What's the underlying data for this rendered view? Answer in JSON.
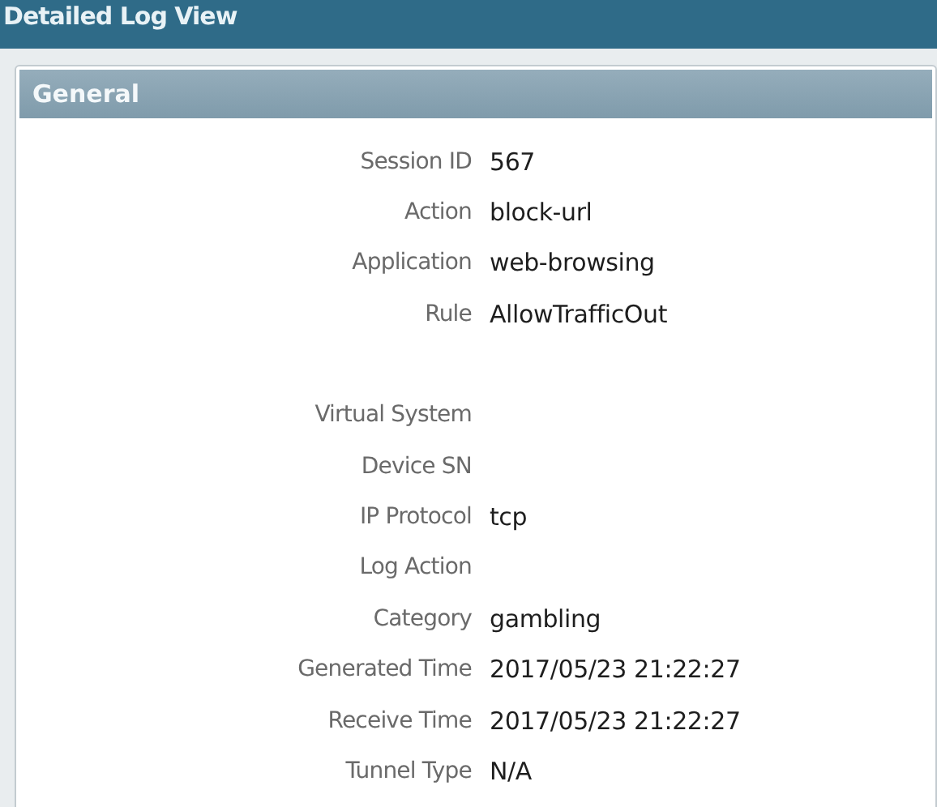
{
  "window": {
    "title": "Detailed Log View"
  },
  "panel": {
    "title": "General",
    "groups": [
      [
        {
          "label": "Session ID",
          "value": "567"
        },
        {
          "label": "Action",
          "value": "block-url"
        },
        {
          "label": "Application",
          "value": "web-browsing"
        },
        {
          "label": "Rule",
          "value": "AllowTrafficOut"
        }
      ],
      [
        {
          "label": "Virtual System"
        },
        {
          "label": "Device SN"
        },
        {
          "label": "IP Protocol",
          "value": "tcp"
        },
        {
          "label": "Log Action"
        },
        {
          "label": "Category",
          "value": "gambling"
        },
        {
          "label": "Generated Time",
          "value": "2017/05/23 21:22:27"
        },
        {
          "label": "Receive Time",
          "value": "2017/05/23 21:22:27"
        },
        {
          "label": "Tunnel Type",
          "value": "N/A"
        }
      ]
    ]
  }
}
